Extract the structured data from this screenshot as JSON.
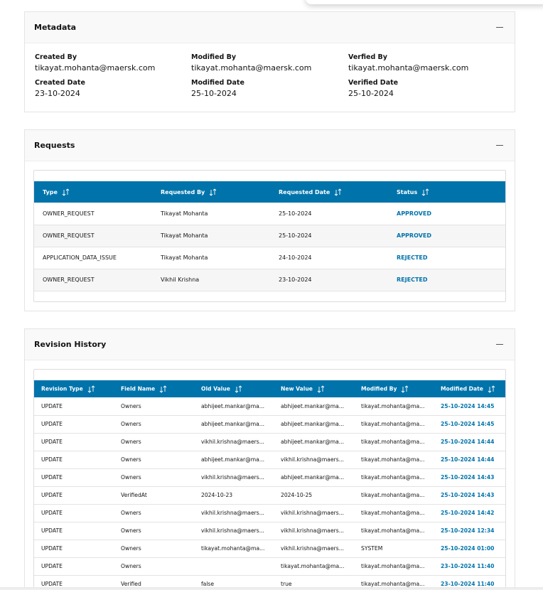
{
  "metadata": {
    "title": "Metadata",
    "fields": [
      {
        "label": "Created By",
        "value": "tikayat.mohanta@maersk.com"
      },
      {
        "label": "Modified By",
        "value": "tikayat.mohanta@maersk.com"
      },
      {
        "label": "Verfied By",
        "value": "tikayat.mohanta@maersk.com"
      },
      {
        "label": "Created Date",
        "value": "23-10-2024"
      },
      {
        "label": "Modified Date",
        "value": "25-10-2024"
      },
      {
        "label": "Verified Date",
        "value": "25-10-2024"
      }
    ]
  },
  "requests": {
    "title": "Requests",
    "columns": [
      "Type",
      "Requested By",
      "Requested Date",
      "Status"
    ],
    "rows": [
      [
        "OWNER_REQUEST",
        "Tikayat Mohanta",
        "25-10-2024",
        "APPROVED"
      ],
      [
        "OWNER_REQUEST",
        "Tikayat Mohanta",
        "25-10-2024",
        "APPROVED"
      ],
      [
        "APPLICATION_DATA_ISSUE",
        "Tikayat Mohanta",
        "24-10-2024",
        "REJECTED"
      ],
      [
        "OWNER_REQUEST",
        "Vikhil Krishna",
        "23-10-2024",
        "REJECTED"
      ]
    ]
  },
  "revision": {
    "title": "Revision History",
    "columns": [
      "Revision Type",
      "Field Name",
      "Old Value",
      "New Value",
      "Modified By",
      "Modified Date"
    ],
    "rows": [
      [
        "UPDATE",
        "Owners",
        "abhijeet.mankar@ma...",
        "abhijeet.mankar@ma...",
        "tikayat.mohanta@ma...",
        "25-10-2024 14:45"
      ],
      [
        "UPDATE",
        "Owners",
        "abhijeet.mankar@ma...",
        "abhijeet.mankar@ma...",
        "tikayat.mohanta@ma...",
        "25-10-2024 14:45"
      ],
      [
        "UPDATE",
        "Owners",
        "vikhil.krishna@maers...",
        "abhijeet.mankar@ma...",
        "tikayat.mohanta@ma...",
        "25-10-2024 14:44"
      ],
      [
        "UPDATE",
        "Owners",
        "abhijeet.mankar@ma...",
        "vikhil.krishna@maers...",
        "tikayat.mohanta@ma...",
        "25-10-2024 14:44"
      ],
      [
        "UPDATE",
        "Owners",
        "vikhil.krishna@maers...",
        "abhijeet.mankar@ma...",
        "tikayat.mohanta@ma...",
        "25-10-2024 14:43"
      ],
      [
        "UPDATE",
        "VerifiedAt",
        "2024-10-23",
        "2024-10-25",
        "tikayat.mohanta@ma...",
        "25-10-2024 14:43"
      ],
      [
        "UPDATE",
        "Owners",
        "vikhil.krishna@maers...",
        "vikhil.krishna@maers...",
        "tikayat.mohanta@ma...",
        "25-10-2024 14:42"
      ],
      [
        "UPDATE",
        "Owners",
        "vikhil.krishna@maers...",
        "vikhil.krishna@maers...",
        "tikayat.mohanta@ma...",
        "25-10-2024 12:34"
      ],
      [
        "UPDATE",
        "Owners",
        "tikayat.mohanta@ma...",
        "vikhil.krishna@maers...",
        "SYSTEM",
        "25-10-2024 01:00"
      ],
      [
        "UPDATE",
        "Owners",
        "",
        "tikayat.mohanta@ma...",
        "tikayat.mohanta@ma...",
        "23-10-2024 11:40"
      ],
      [
        "UPDATE",
        "Verified",
        "false",
        "true",
        "tikayat.mohanta@ma...",
        "23-10-2024 11:40"
      ]
    ]
  },
  "colors": {
    "header_blue": "#0073ab",
    "status_blue": "#0073ab"
  },
  "icons": {
    "collapse": "minus-icon",
    "sort": "sort-arrows-icon"
  }
}
